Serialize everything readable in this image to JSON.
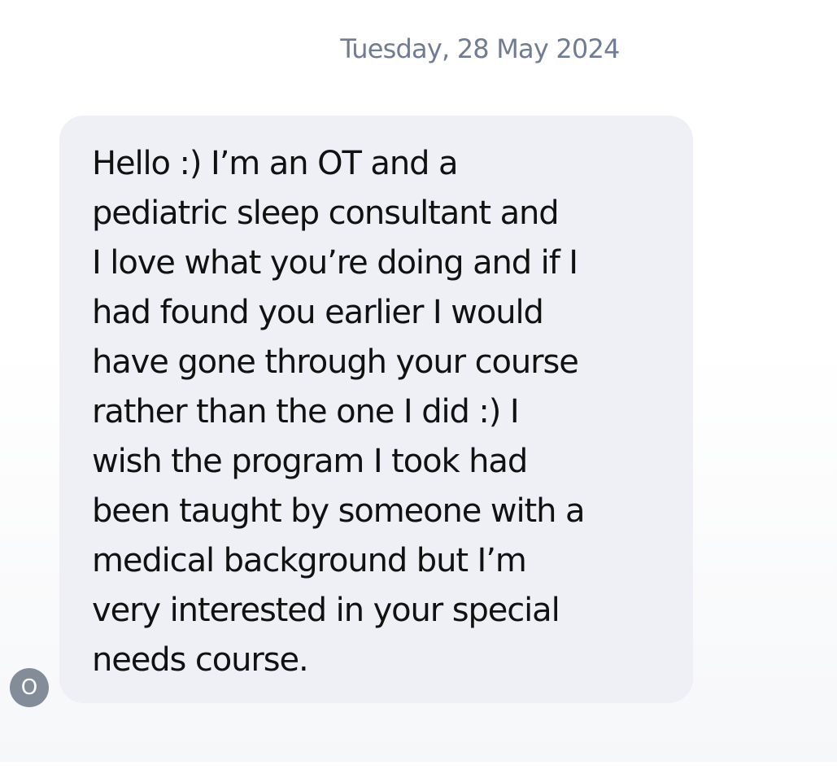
{
  "conversation": {
    "date_header": "Tuesday, 28 May 2024",
    "message": {
      "text": "Hello :) I’m an OT and a\npediatric sleep consultant and\nI love what you’re doing and if I\nhad found you earlier I would\nhave gone through your course\nrather than the one I did :) I\nwish the program I took had\nbeen taught by someone with a\nmedical background but I’m\nvery interested in your special\nneeds course."
    },
    "sender_avatar": {
      "initial": "O"
    }
  },
  "colors": {
    "bubble_background": "#eef0f5",
    "date_text": "#6f7c93",
    "message_text": "#111111",
    "avatar_background": "#838c99"
  }
}
